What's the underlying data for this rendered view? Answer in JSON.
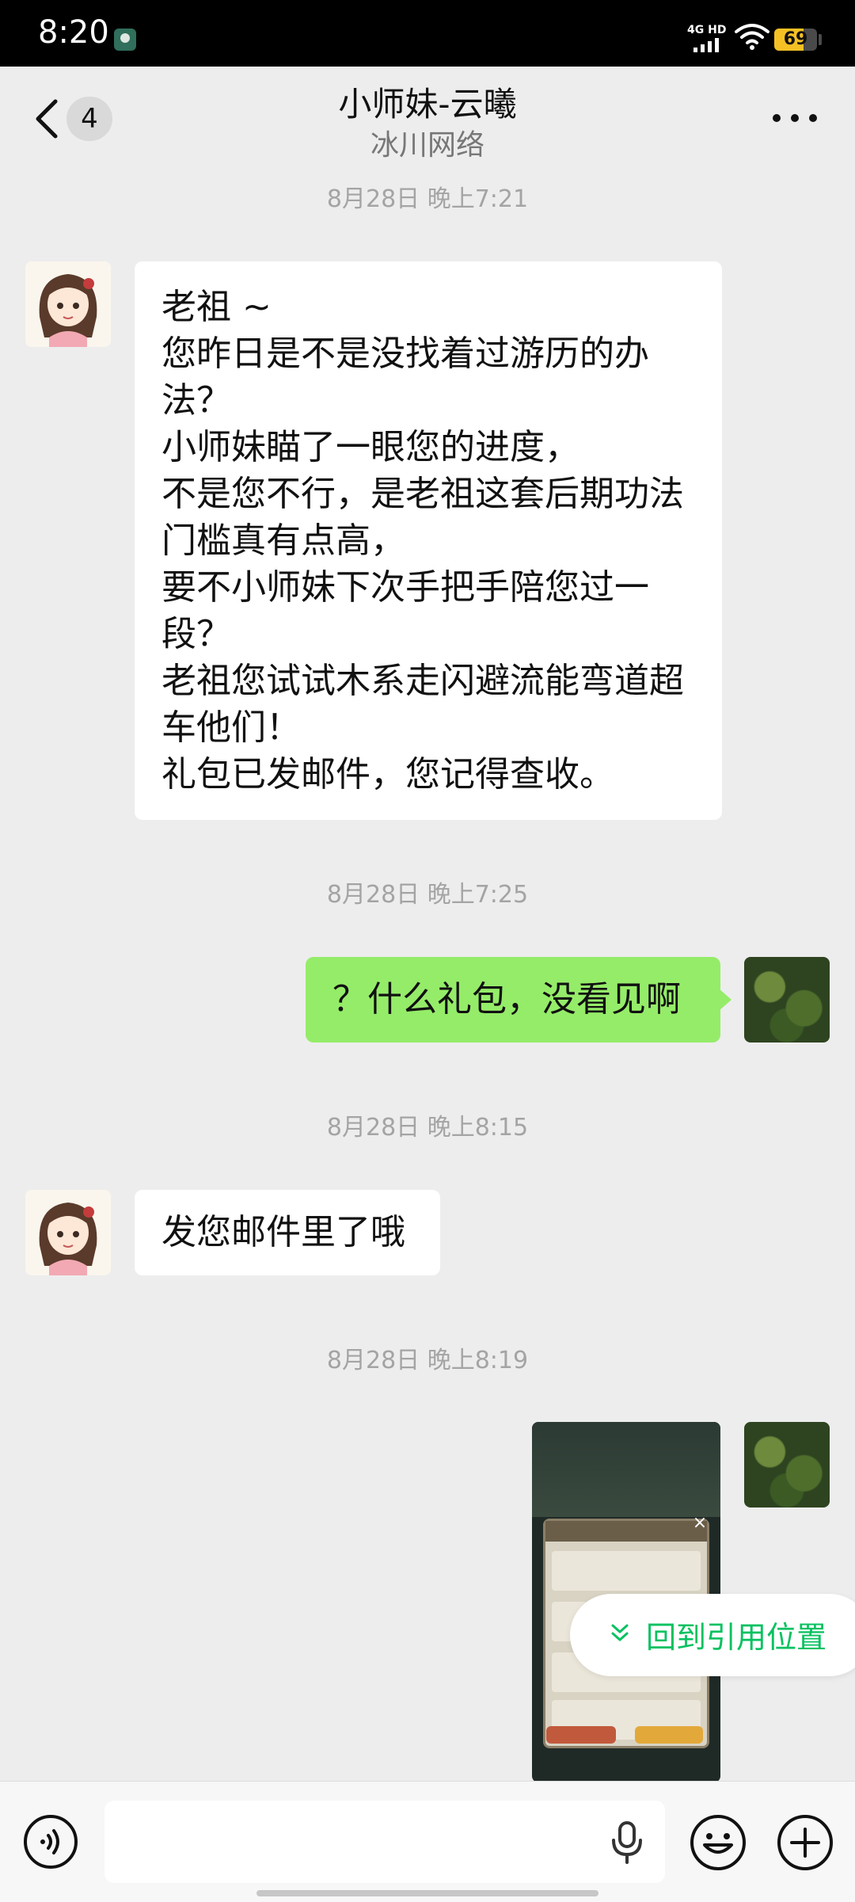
{
  "status_bar": {
    "time": "8:20",
    "network_label": "4G HD",
    "battery_level": 69,
    "battery_text": "69",
    "battery_color": "#f5c024",
    "icons": [
      "app-notification-icon",
      "signal-icon",
      "wifi-icon",
      "battery-icon"
    ]
  },
  "header": {
    "unread_count": "4",
    "title": "小师妹-云曦",
    "subtitle": "冰川网络",
    "icons": [
      "back-chevron-icon",
      "more-dots-icon"
    ]
  },
  "messages": [
    {
      "timestamp": "8月28日 晚上7:21"
    },
    {
      "from": "contact",
      "lines": [
        "老祖 ~",
        "您昨日是不是没找着过游历的办",
        "法？",
        "小师妹瞄了一眼您的进度，",
        "不是您不行，是老祖这套后期功法",
        "门槛真有点高，",
        "要不小师妹下次手把手陪您过一",
        "段？",
        "老祖您试试木系走闪避流能弯道超",
        "车他们！",
        "礼包已发邮件，您记得查收。"
      ]
    },
    {
      "timestamp": "8月28日 晚上7:25"
    },
    {
      "from": "me",
      "text": "？什么礼包，没看见啊"
    },
    {
      "timestamp": "8月28日 晚上8:15"
    },
    {
      "from": "contact",
      "text": "发您邮件里了哦"
    },
    {
      "timestamp": "8月28日 晚上8:19"
    },
    {
      "from": "me",
      "type": "image",
      "content": "game-mail-screenshot"
    }
  ],
  "jump_back": {
    "label": "回到引用位置",
    "color": "#07c160"
  },
  "input_bar": {
    "placeholder": "",
    "icons": [
      "voice-icon",
      "microphone-icon",
      "emoji-icon",
      "plus-icon"
    ]
  },
  "colors": {
    "background": "#ededed",
    "my_bubble": "#95ec69",
    "their_bubble": "#ffffff",
    "timestamp": "#a4a4a4"
  }
}
